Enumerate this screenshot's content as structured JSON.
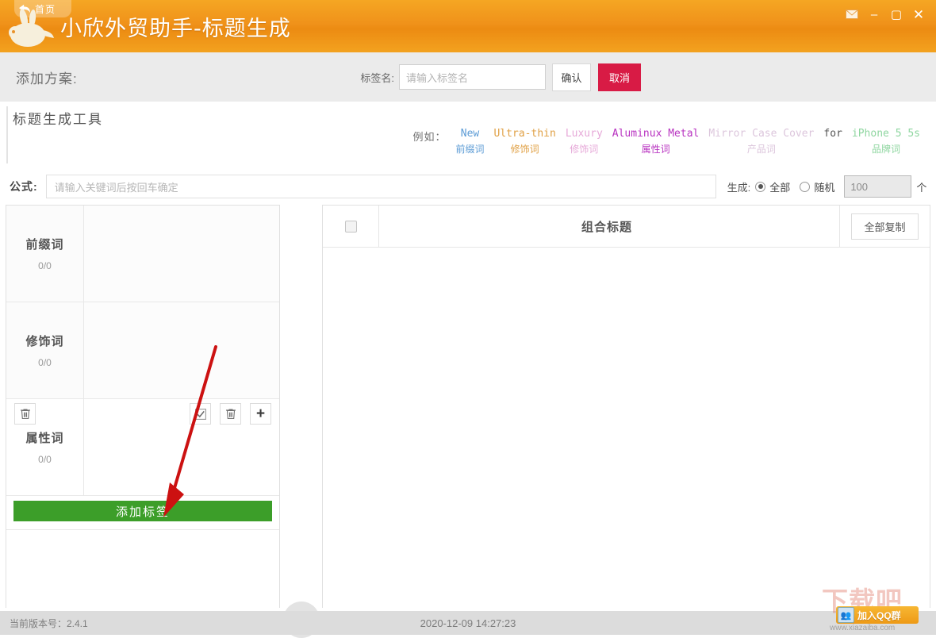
{
  "window": {
    "home_tab_label": "首页",
    "app_title": "小欣外贸助手-标题生成",
    "controls": {
      "mail": "mail-icon",
      "minimize": "–",
      "maximize": "▢",
      "close": "✕"
    }
  },
  "plan_bar": {
    "title": "添加方案:",
    "tag_label": "标签名:",
    "tag_placeholder": "请输入标签名",
    "tag_value": "",
    "confirm_label": "确认",
    "cancel_label": "取消",
    "cancel_color": "#d81b45"
  },
  "tool_section": {
    "title": "标题生成工具",
    "example_label": "例如：",
    "examples": [
      {
        "en": "New",
        "cn": "前缀词",
        "color": "#5b9bd5"
      },
      {
        "en": "Ultra-thin",
        "cn": "修饰词",
        "color": "#e0a044"
      },
      {
        "en": "Luxury",
        "cn": "修饰词",
        "color": "#e6a8d8"
      },
      {
        "en": "Aluminux Metal",
        "cn": "属性词",
        "color": "#b832c0"
      },
      {
        "en": "Mirror Case Cover",
        "cn": "产品词",
        "color": "#dcc6dc"
      },
      {
        "en": "for",
        "cn": "",
        "color": "#555555"
      },
      {
        "en": "iPhone 5 5s",
        "cn": "品牌词",
        "color": "#8fd6a0"
      }
    ]
  },
  "formula": {
    "label": "公式:",
    "placeholder": "请输入关键词后按回车确定",
    "value": "",
    "generate_label": "生成:",
    "option_all": "全部",
    "option_random": "随机",
    "selected_option": "全部",
    "random_count": "100",
    "count_unit": "个"
  },
  "left_panel": {
    "rows": [
      {
        "name": "前缀词",
        "count": "0/0"
      },
      {
        "name": "修饰词",
        "count": "0/0"
      },
      {
        "name": "属性词",
        "count": "0/0"
      }
    ],
    "row_tools": {
      "delete_left": "trash-icon",
      "select_all": "check-square-icon",
      "delete": "trash-icon",
      "add": "plus-icon"
    },
    "add_tag_label": "添加标签",
    "add_tag_color": "#3c9e29"
  },
  "transfer": {
    "arrow_label": "arrow-right-icon"
  },
  "right_panel": {
    "select_all_checkbox": false,
    "title": "组合标题",
    "copy_all_label": "全部复制",
    "rows": []
  },
  "footer": {
    "version_text": "当前版本号：2.4.1",
    "clock": "2020-12-09 14:27:23"
  },
  "watermark": {
    "brand": "下载吧",
    "url": "www.xiazaiba.com",
    "qq_label": "加入QQ群"
  }
}
